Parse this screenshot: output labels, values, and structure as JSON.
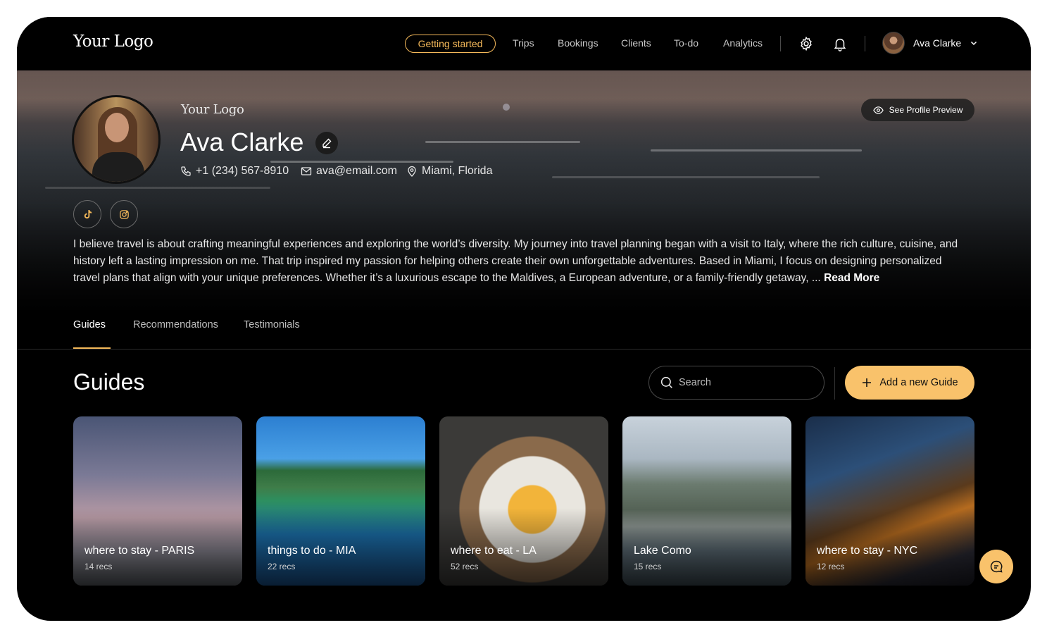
{
  "nav": {
    "logo": "Your Logo",
    "getting_started": "Getting started",
    "links": [
      "Trips",
      "Bookings",
      "Clients",
      "To-do",
      "Analytics"
    ],
    "user_name": "Ava Clarke"
  },
  "profile": {
    "brand": "Your Logo",
    "name": "Ava Clarke",
    "phone": "+1 (234) 567-8910",
    "email": "ava@email.com",
    "location": "Miami, Florida",
    "preview_label": "See Profile Preview",
    "bio": "I believe travel is about crafting meaningful experiences and exploring the world’s diversity. My journey into travel planning began with a visit to Italy, where the rich culture, cuisine, and history left a lasting impression on me. That trip inspired my passion for helping others create their own unforgettable adventures. Based in Miami, I focus on designing personalized travel plans that align with your unique preferences. Whether it’s a luxurious escape to the Maldives, a European adventure, or a family-friendly getaway, ...",
    "read_more": "Read More"
  },
  "tabs": [
    "Guides",
    "Recommendations",
    "Testimonials"
  ],
  "guides": {
    "title": "Guides",
    "search_placeholder": "Search",
    "add_label": "Add a new Guide",
    "cards": [
      {
        "title": "where to stay - PARIS",
        "count": "14 recs"
      },
      {
        "title": "things to do - MIA",
        "count": "22 recs"
      },
      {
        "title": "where to eat - LA",
        "count": "52 recs"
      },
      {
        "title": "Lake Como",
        "count": "15 recs"
      },
      {
        "title": "where to stay - NYC",
        "count": "12 recs"
      }
    ]
  },
  "colors": {
    "accent": "#f5b95a",
    "button": "#f9c26b",
    "background": "#000000"
  }
}
